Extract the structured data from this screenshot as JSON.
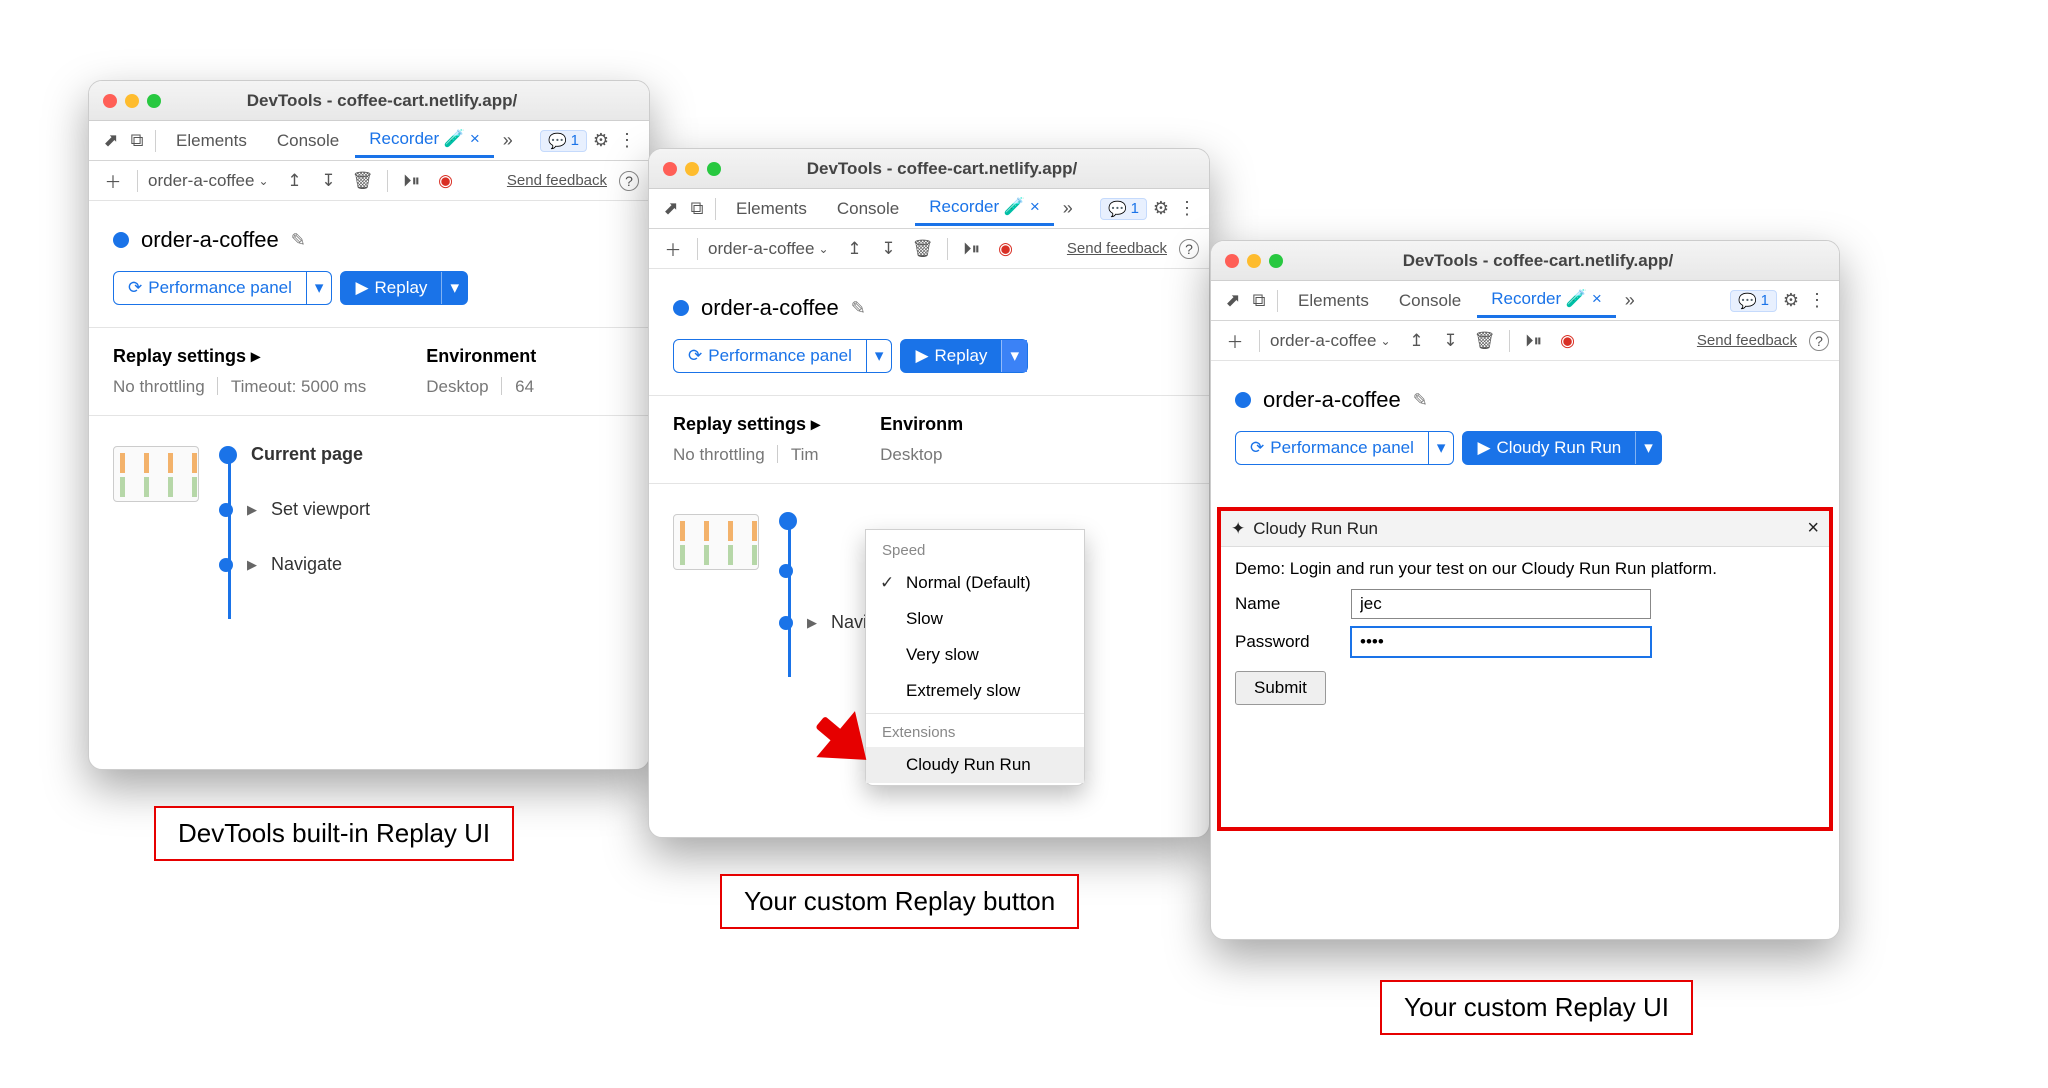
{
  "window_title": "DevTools - coffee-cart.netlify.app/",
  "tabs": {
    "elements": "Elements",
    "console": "Console",
    "recorder": "Recorder",
    "issues_count": "1"
  },
  "icons": {
    "flask": "🧪",
    "close": "×",
    "more": "»",
    "chat": "💬",
    "gear": "⚙",
    "kebab": "⋮",
    "plus": "＋",
    "chev": "⌄",
    "export": "↥",
    "import": "↧",
    "trash": "🗑",
    "step": "⏵⏸",
    "record": "◉",
    "help": "?",
    "inspect": "⬈",
    "device": "⧉",
    "play": "▶",
    "perf": "⟳"
  },
  "toolbar": {
    "recording_name": "order-a-coffee",
    "feedback": "Send feedback"
  },
  "recording": {
    "title": "order-a-coffee",
    "perf_button": "Performance panel",
    "replay_button": "Replay",
    "custom_replay_button": "Cloudy Run Run"
  },
  "settings": {
    "heading": "Replay settings",
    "throttling": "No throttling",
    "timeout": "Timeout: 5000 ms",
    "env_heading": "Environment",
    "env_line": "Desktop",
    "env_extra": "64"
  },
  "steps": {
    "s1": "Current page",
    "s2": "Set viewport",
    "s3": "Navigate"
  },
  "menu": {
    "speed_hdr": "Speed",
    "normal": "Normal (Default)",
    "slow": "Slow",
    "very_slow": "Very slow",
    "extremely_slow": "Extremely slow",
    "ext_hdr": "Extensions",
    "ext_item": "Cloudy Run Run"
  },
  "ext": {
    "title": "Cloudy Run Run",
    "desc": "Demo: Login and run your test on our Cloudy Run Run platform.",
    "name_label": "Name",
    "name_value": "jec",
    "pwd_label": "Password",
    "pwd_value": "••••",
    "submit": "Submit"
  },
  "captions": {
    "a": "DevTools built-in Replay UI",
    "b": "Your custom Replay button",
    "c": "Your custom Replay UI"
  }
}
